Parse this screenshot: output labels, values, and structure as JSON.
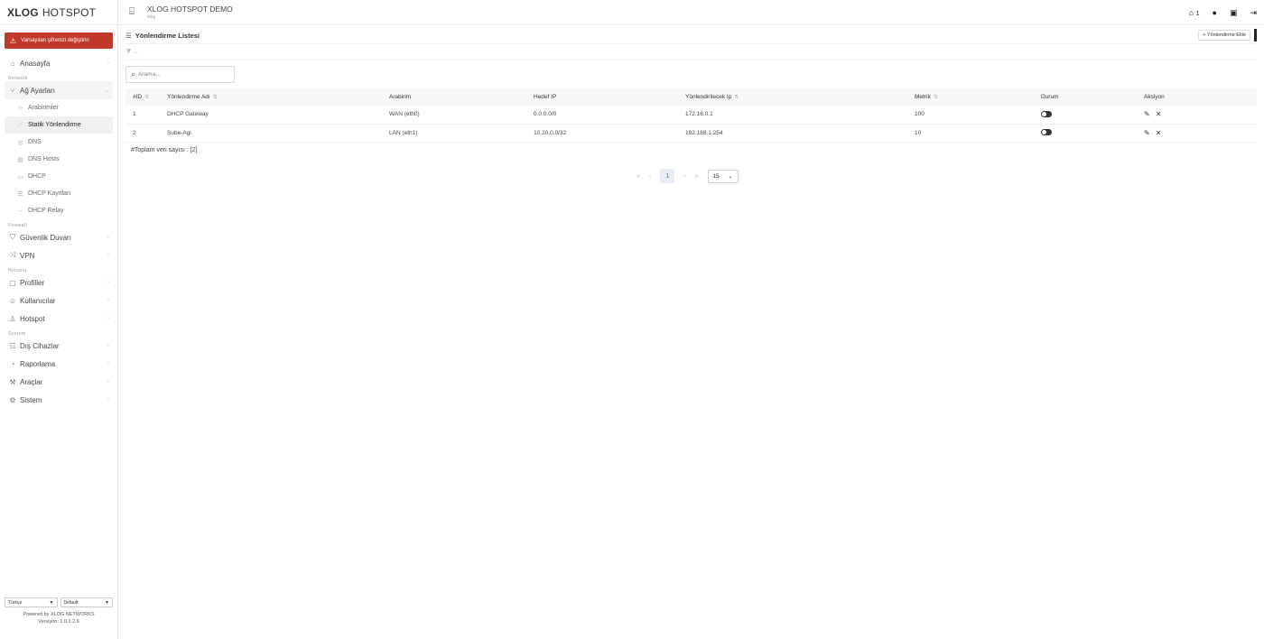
{
  "brand": {
    "bold": "XLOG",
    "rest": "HOTSPOT"
  },
  "sidebar": {
    "warning": "Varsayılan şifrenizi değiştirin",
    "home": "Anasayfa",
    "section_network": "Network",
    "network_group": "Ağ Ayarları",
    "network_items": [
      "Arabirimler",
      "Statik Yönlendirme",
      "DNS",
      "DNS Hosts",
      "DHCP",
      "DHCP Kayıtları",
      "DHCP Relay"
    ],
    "section_firewall": "Firewall",
    "firewall": "Güvenlik Duvarı",
    "vpn": "VPN",
    "section_hotspot": "Hotspot",
    "profiles": "Profiller",
    "users": "Kullanıcılar",
    "hotspot": "Hotspot",
    "section_system": "System",
    "devices": "Dış Cihazlar",
    "reporting": "Raporlama",
    "tools": "Araçlar",
    "system": "Sistem"
  },
  "footer": {
    "language": "Türkçe",
    "theme": "Default",
    "powered": "Powered by XLOG NETWORKS",
    "version": "Versiyon: 1.0.1.2.6"
  },
  "topbar": {
    "title": "XLOG HOTSPOT DEMO",
    "subtitle": "xlog",
    "notif_count": "1"
  },
  "main": {
    "title": "Yönlendirme Listesi",
    "add_label": "+ Yönlendirme Ekle",
    "filter_text": "...",
    "search_placeholder": "Arama...",
    "columns": [
      "#ID",
      "Yönlendirme Adı",
      "Arabirim",
      "Hedef IP",
      "Yönlendirilecek Ip",
      "Metrik",
      "Durum",
      "Aksiyon"
    ],
    "rows": [
      {
        "id": "1",
        "name": "DHCP Gateway",
        "iface": "WAN (eth0)",
        "dest": "0.0.0.0/0",
        "gw": "172.16.0.1",
        "metric": "100",
        "enabled": true
      },
      {
        "id": "2",
        "name": "Sube-Agi",
        "iface": "LAN (eth1)",
        "dest": "10.20.0.0/32",
        "gw": "192.168.1.254",
        "metric": "10",
        "enabled": true
      }
    ],
    "total": "#Toplam veri sayısı : [2]"
  },
  "pager": {
    "current": "1",
    "page_size": "15"
  }
}
